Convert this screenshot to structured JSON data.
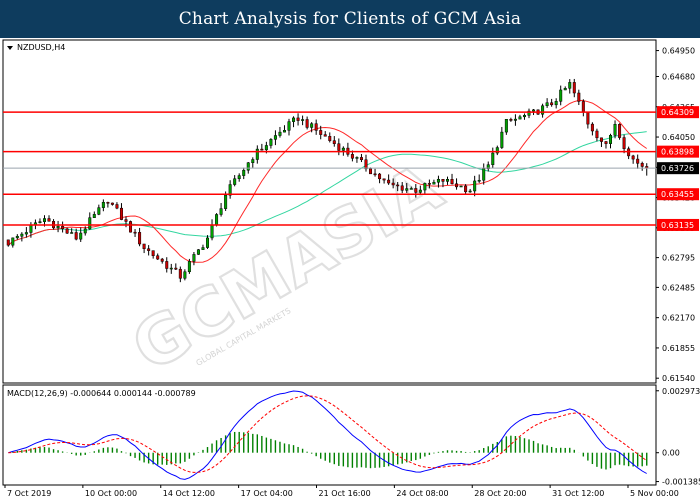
{
  "header": {
    "title": "Chart Analysis for Clients of GCM Asia"
  },
  "watermark": {
    "text": "GCMASIA",
    "sub": "GLOBAL CAPITAL MARKETS"
  },
  "chart_data": [
    {
      "type": "candlestick",
      "symbol_label": "NZDUSD,H4",
      "ylim": [
        0.6149,
        0.6506
      ],
      "y_ticks": [
        "0.64950",
        "0.64680",
        "0.64365",
        "0.64050",
        "0.63735",
        "0.63420",
        "0.63105",
        "0.62795",
        "0.62485",
        "0.62170",
        "0.61855",
        "0.61540"
      ],
      "x_ticks": [
        "7 Oct 2019",
        "10 Oct 00:00",
        "14 Oct 12:00",
        "17 Oct 04:00",
        "21 Oct 16:00",
        "24 Oct 08:00",
        "28 Oct 20:00",
        "31 Oct 12:00",
        "5 Nov 00:00"
      ],
      "current_price": {
        "label": "0.63726",
        "value": 0.63726,
        "color": "#000000"
      },
      "horizontal_levels": [
        {
          "label": "0.64309",
          "value": 0.64309
        },
        {
          "label": "0.63898",
          "value": 0.63898
        },
        {
          "label": "0.63455",
          "value": 0.63455
        },
        {
          "label": "0.63135",
          "value": 0.63135
        }
      ],
      "level_color": "#ff0000",
      "candle_up_color": "#00a000",
      "candle_down_color": "#cc0000",
      "ma_fast_color": "#ff2a2a",
      "ma_slow_color": "#33d6a0",
      "key_points": [
        {
          "idx": 0,
          "close": 0.6295
        },
        {
          "idx": 8,
          "close": 0.632
        },
        {
          "idx": 15,
          "close": 0.63
        },
        {
          "idx": 22,
          "close": 0.634
        },
        {
          "idx": 30,
          "close": 0.629
        },
        {
          "idx": 38,
          "close": 0.626
        },
        {
          "idx": 44,
          "close": 0.63
        },
        {
          "idx": 48,
          "close": 0.6345
        },
        {
          "idx": 54,
          "close": 0.6385
        },
        {
          "idx": 60,
          "close": 0.641
        },
        {
          "idx": 64,
          "close": 0.6425
        },
        {
          "idx": 70,
          "close": 0.6405
        },
        {
          "idx": 76,
          "close": 0.6385
        },
        {
          "idx": 84,
          "close": 0.6355
        },
        {
          "idx": 90,
          "close": 0.635
        },
        {
          "idx": 96,
          "close": 0.636
        },
        {
          "idx": 102,
          "close": 0.635
        },
        {
          "idx": 106,
          "close": 0.6375
        },
        {
          "idx": 110,
          "close": 0.642
        },
        {
          "idx": 116,
          "close": 0.643
        },
        {
          "idx": 120,
          "close": 0.644
        },
        {
          "idx": 124,
          "close": 0.646
        },
        {
          "idx": 128,
          "close": 0.642
        },
        {
          "idx": 132,
          "close": 0.6395
        },
        {
          "idx": 134,
          "close": 0.642
        },
        {
          "idx": 137,
          "close": 0.6385
        },
        {
          "idx": 141,
          "close": 0.63726
        }
      ]
    },
    {
      "type": "macd",
      "label": "MACD(12,26,9)",
      "values_text": "-0.000644 0.000144 -0.000789",
      "params": [
        12,
        26,
        9
      ],
      "ylim": [
        -0.00155,
        0.00325
      ],
      "y_ticks": [
        "0.002973",
        "0.00",
        "-0.001385"
      ],
      "main_color": "#0000ff",
      "signal_color": "#ff0000",
      "hist_color": "#008000"
    }
  ]
}
